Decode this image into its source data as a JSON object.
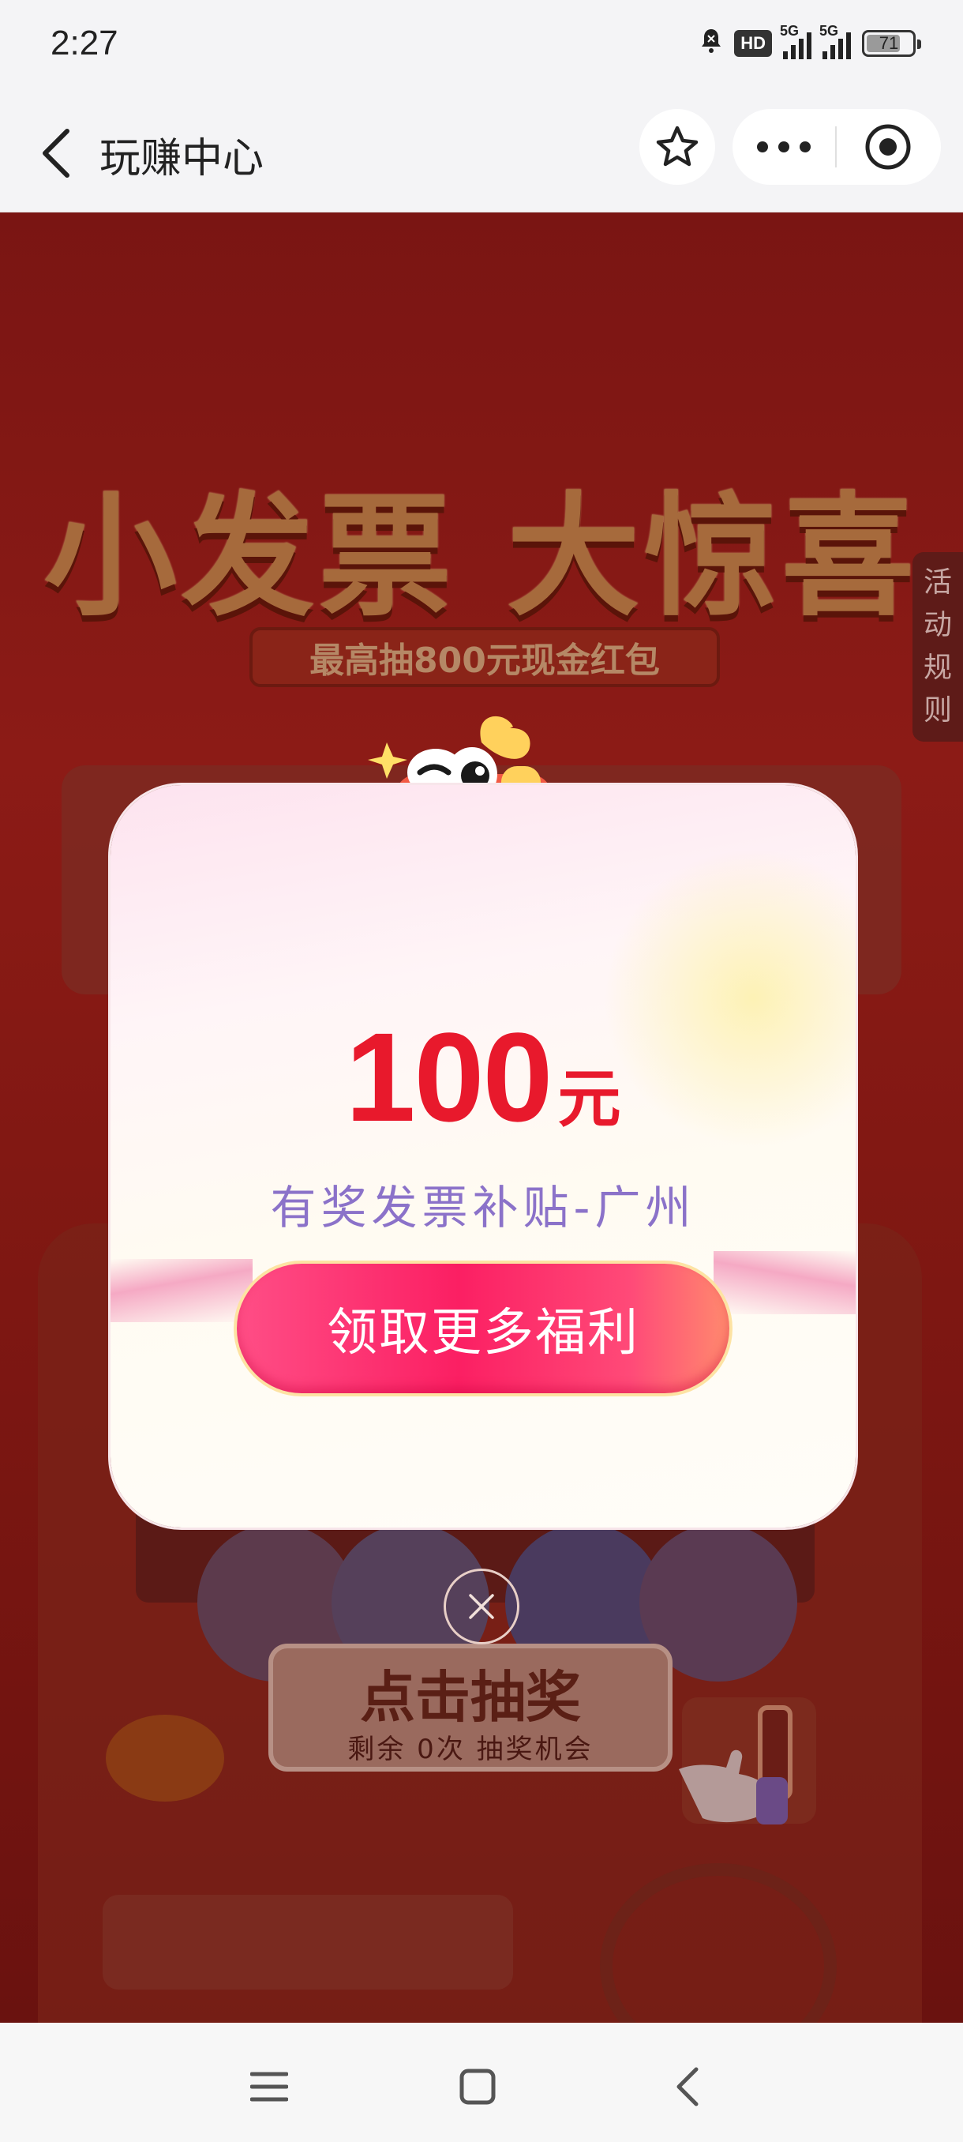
{
  "status_bar": {
    "time": "2:27",
    "hd_label": "HD",
    "signal_1_tag": "5G",
    "signal_2_tag": "5G",
    "battery": "71",
    "icons": [
      "bell-muted-icon",
      "hd-icon",
      "signal-icon",
      "signal-icon",
      "battery-icon"
    ]
  },
  "nav_bar": {
    "title": "玩赚中心",
    "icons": [
      "back-arrow-icon",
      "star-icon",
      "more-dots-icon",
      "target-circle-icon"
    ]
  },
  "banner": {
    "title": "小发票 大惊喜",
    "subtitle": "最高抽800元现金红包"
  },
  "rules_tab": {
    "chars": [
      "活",
      "动",
      "规",
      "则"
    ]
  },
  "draw_button": {
    "title": "点击抽奖",
    "remaining": "剩余 0次 抽奖机会"
  },
  "popup": {
    "amount": "100",
    "unit": "元",
    "description": "有奖发票补贴-广州",
    "claim_button": "领取更多福利",
    "accent_color": "#e8192c",
    "desc_color": "#8b72c9",
    "button_color": "#fb1f63"
  },
  "android_nav": {
    "icons": [
      "menu-icon",
      "home-square-icon",
      "back-chevron-icon"
    ]
  }
}
